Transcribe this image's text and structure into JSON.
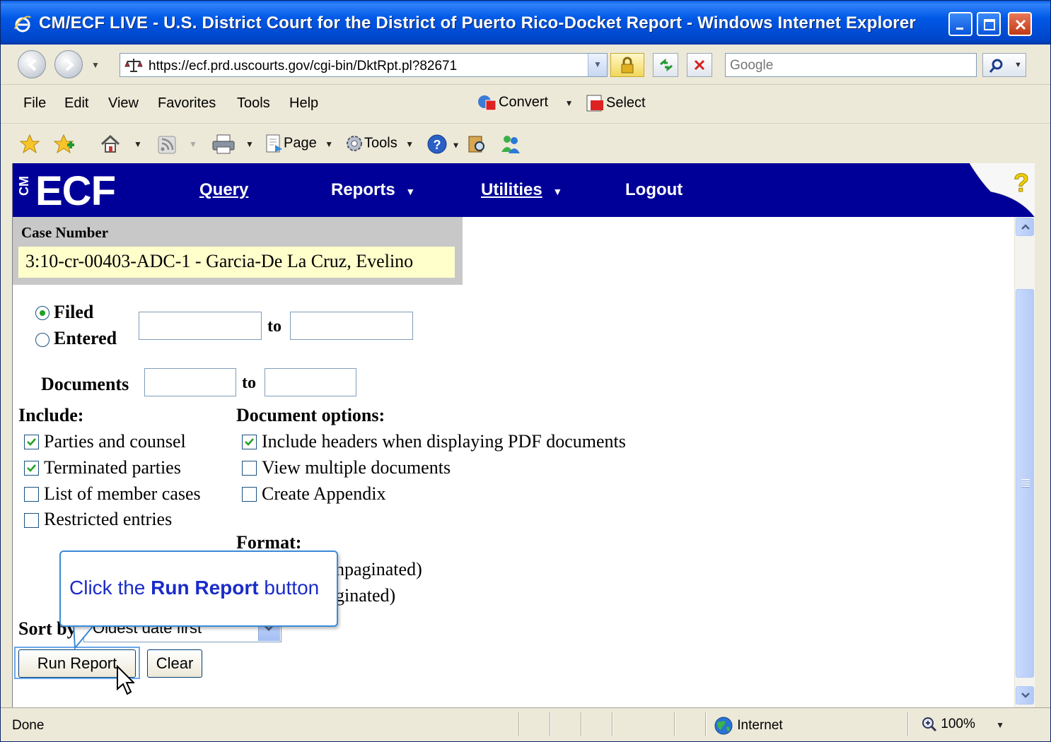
{
  "window": {
    "title": "CM/ECF LIVE - U.S. District Court for the District of Puerto Rico-Docket Report - Windows Internet Explorer"
  },
  "address": {
    "url": "https://ecf.prd.uscourts.gov/cgi-bin/DktRpt.pl?82671",
    "search_placeholder": "Google"
  },
  "menu": {
    "items": [
      "File",
      "Edit",
      "View",
      "Favorites",
      "Tools",
      "Help"
    ],
    "convert": "Convert",
    "select": "Select"
  },
  "commandbar": {
    "page": "Page",
    "tools": "Tools"
  },
  "ecf": {
    "logo": "ECF",
    "logo_prefix": "CM",
    "nav": [
      "Query",
      "Reports",
      "Utilities",
      "Logout"
    ],
    "help": "?"
  },
  "case": {
    "label": "Case Number",
    "value": "3:10-cr-00403-ADC-1 - Garcia-De La Cruz, Evelino"
  },
  "form": {
    "date_options": [
      {
        "label": "Filed",
        "selected": true
      },
      {
        "label": "Entered",
        "selected": false
      }
    ],
    "to": "to",
    "documents_label": "Documents",
    "include_heading": "Include:",
    "include": [
      {
        "label": "Parties and counsel",
        "checked": true
      },
      {
        "label": "Terminated parties",
        "checked": true
      },
      {
        "label": "List of member cases",
        "checked": false
      },
      {
        "label": "Restricted entries",
        "checked": false
      }
    ],
    "doc_options_heading": "Document options:",
    "doc_options": [
      {
        "label": "Include headers when displaying PDF documents",
        "checked": true
      },
      {
        "label": "View multiple documents",
        "checked": false
      },
      {
        "label": "Create Appendix",
        "checked": false
      }
    ],
    "format_heading": "Format:",
    "format_partial_1": "npaginated)",
    "format_partial_2": "ginated)",
    "sort_label": "Sort by",
    "sort_value": "Oldest date first",
    "run_button": "Run Report",
    "clear_button": "Clear"
  },
  "callout": {
    "text_before": "Click the ",
    "text_bold": "Run Report",
    "text_after": " button"
  },
  "status": {
    "left": "Done",
    "zone": "Internet",
    "zoom": "100%"
  },
  "colors": {
    "ecf_bar": "#000099",
    "title_bar": "#0058e6",
    "case_value_bg": "#ffffcc",
    "callout_text": "#1b2cc8"
  }
}
